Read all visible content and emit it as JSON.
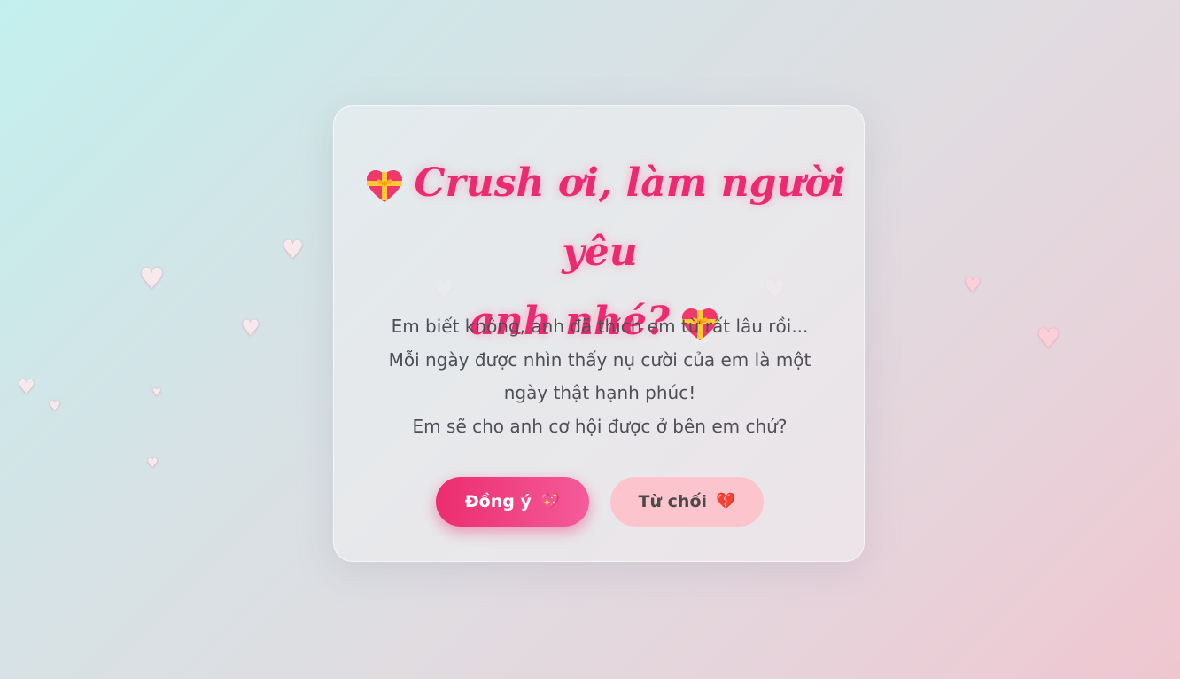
{
  "dialog": {
    "title_line1": "Crush ơi, làm người yêu",
    "title_line2": "anh nhé?",
    "title_icon": "heart-with-ribbon-icon",
    "message_lines": [
      "Em biết không, anh đã thích em từ rất lâu rồi...",
      "Mỗi ngày được nhìn thấy nụ cười của em là một ngày thật hạnh phúc!",
      "Em sẽ cho anh cơ hội được ở bên em chứ?"
    ],
    "accept_button": {
      "label": "Đồng ý",
      "icon": "sparkling-heart-icon",
      "icon_glyph": "💖"
    },
    "decline_button": {
      "label": "Từ chối",
      "icon": "broken-heart-icon",
      "icon_glyph": "💔"
    }
  },
  "theme": {
    "accent": "#ec2a72",
    "accept_bg": "#eb2d6e",
    "decline_bg": "#fcc4cd",
    "text": "#4f4f57",
    "floating_heart_glyph": "♥"
  }
}
